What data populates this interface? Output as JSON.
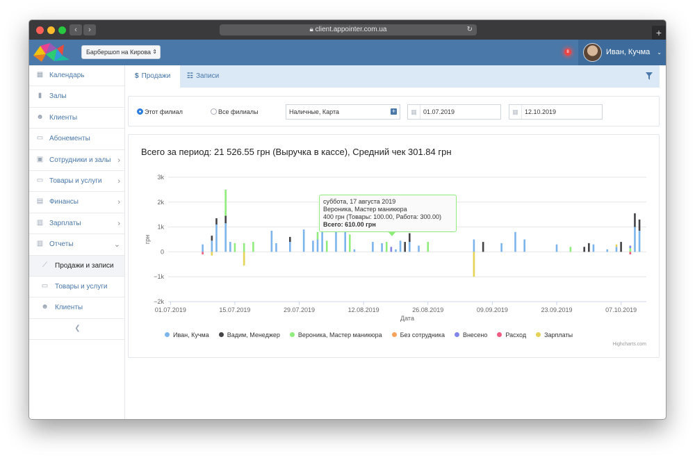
{
  "browser": {
    "url": "client.appointer.com.ua",
    "back_glyph": "‹",
    "forward_glyph": "›",
    "newtab_glyph": "+"
  },
  "header": {
    "branch": "Барбершоп на Кирова",
    "notification_count": "8",
    "user": "Иван, Кучма"
  },
  "sidebar": {
    "items": [
      {
        "label": "Календарь",
        "icon": "calendar-icon",
        "glyph": "▦",
        "chevron": ""
      },
      {
        "label": "Залы",
        "icon": "bookmark-icon",
        "glyph": "▮",
        "chevron": ""
      },
      {
        "label": "Клиенты",
        "icon": "users-icon",
        "glyph": "☻",
        "chevron": ""
      },
      {
        "label": "Абонементы",
        "icon": "card-icon",
        "glyph": "▭",
        "chevron": ""
      },
      {
        "label": "Сотрудники и залы",
        "icon": "id-card-icon",
        "glyph": "▣",
        "chevron": "›"
      },
      {
        "label": "Товары и услуги",
        "icon": "card-icon",
        "glyph": "▭",
        "chevron": "›"
      },
      {
        "label": "Финансы",
        "icon": "money-icon",
        "glyph": "▤",
        "chevron": "›"
      },
      {
        "label": "Зарплаты",
        "icon": "document-icon",
        "glyph": "▥",
        "chevron": "›"
      },
      {
        "label": "Отчеты",
        "icon": "bar-chart-icon",
        "glyph": "▥",
        "chevron": "⌄"
      }
    ],
    "subitems": [
      {
        "label": "Продажи и записи",
        "icon": "line-chart-icon",
        "glyph": "⟋",
        "active": true
      },
      {
        "label": "Товары и услуги",
        "icon": "card-icon",
        "glyph": "▭",
        "active": false
      },
      {
        "label": "Клиенты",
        "icon": "users-icon",
        "glyph": "☻",
        "active": false
      }
    ],
    "collapse_glyph": "❮"
  },
  "tabs": [
    {
      "label": "Продажи",
      "icon": "dollar-icon",
      "glyph": "$"
    },
    {
      "label": "Записи",
      "icon": "list-icon",
      "glyph": "☷"
    }
  ],
  "filters": {
    "radio_this": "Этот филиал",
    "radio_all": "Все филиалы",
    "payment": "Наличные, Карта",
    "date_from": "01.07.2019",
    "date_to": "12.10.2019"
  },
  "summary": "Всего за период: 21 526.55 грн (Выручка в кассе), Средний чек 301.84 грн",
  "tooltip": {
    "line1": "суббота, 17 августа 2019",
    "line2": "Вероника, Мастер маникюра",
    "line3": "400 грн (Товары: 100.00, Работа: 300.00)",
    "total_label": "Всего:",
    "total_value": "610.00 грн"
  },
  "credits": "Highcharts.com",
  "colors": {
    "ivan": "#7cb5ec",
    "vadim": "#434348",
    "veronika": "#90ed7d",
    "none": "#f7a35c",
    "deposit": "#8085e9",
    "expense": "#f15c80",
    "salary": "#e4d354"
  },
  "chart_data": {
    "type": "bar",
    "ylabel": "грн",
    "xlabel": "Дата",
    "ylim": [
      -2000,
      3000
    ],
    "yticks": [
      "3k",
      "2k",
      "1k",
      "0",
      "−1k",
      "−2k"
    ],
    "yvalues": [
      3000,
      2000,
      1000,
      0,
      -1000,
      -2000
    ],
    "xticks": [
      "01.07.2019",
      "15.07.2019",
      "29.07.2019",
      "12.08.2019",
      "26.08.2019",
      "09.09.2019",
      "23.09.2019",
      "07.10.2019"
    ],
    "day_range": [
      "2019-07-01",
      "2019-10-12"
    ],
    "grid": true,
    "legend_position": "bottom",
    "series": [
      {
        "name": "Иван, Кучма",
        "color": "#7cb5ec",
        "points": [
          [
            "2019-07-08",
            300
          ],
          [
            "2019-07-10",
            450
          ],
          [
            "2019-07-11",
            1100
          ],
          [
            "2019-07-13",
            1150
          ],
          [
            "2019-07-14",
            400
          ],
          [
            "2019-07-23",
            850
          ],
          [
            "2019-07-24",
            350
          ],
          [
            "2019-07-27",
            400
          ],
          [
            "2019-07-30",
            900
          ],
          [
            "2019-08-01",
            450
          ],
          [
            "2019-08-02",
            500
          ],
          [
            "2019-08-03",
            1150
          ],
          [
            "2019-08-06",
            1050
          ],
          [
            "2019-08-08",
            1100
          ],
          [
            "2019-08-10",
            100
          ],
          [
            "2019-08-14",
            400
          ],
          [
            "2019-08-16",
            350
          ],
          [
            "2019-08-19",
            100
          ],
          [
            "2019-08-20",
            450
          ],
          [
            "2019-08-22",
            400
          ],
          [
            "2019-08-24",
            250
          ],
          [
            "2019-09-05",
            500
          ],
          [
            "2019-09-11",
            350
          ],
          [
            "2019-09-14",
            800
          ],
          [
            "2019-09-16",
            500
          ],
          [
            "2019-09-23",
            300
          ],
          [
            "2019-10-01",
            300
          ],
          [
            "2019-10-04",
            100
          ],
          [
            "2019-10-06",
            200
          ],
          [
            "2019-10-10",
            1000
          ],
          [
            "2019-10-11",
            850
          ]
        ]
      },
      {
        "name": "Вадим, Менеджер",
        "color": "#434348",
        "points": [
          [
            "2019-07-10",
            200
          ],
          [
            "2019-07-11",
            250
          ],
          [
            "2019-07-13",
            300
          ],
          [
            "2019-07-27",
            200
          ],
          [
            "2019-08-06",
            200
          ],
          [
            "2019-08-21",
            400
          ],
          [
            "2019-08-22",
            350
          ],
          [
            "2019-09-07",
            400
          ],
          [
            "2019-09-29",
            200
          ],
          [
            "2019-09-30",
            350
          ],
          [
            "2019-10-07",
            400
          ],
          [
            "2019-10-10",
            550
          ],
          [
            "2019-10-11",
            450
          ]
        ]
      },
      {
        "name": "Вероника, Мастер маникюра",
        "color": "#90ed7d",
        "points": [
          [
            "2019-07-13",
            1050
          ],
          [
            "2019-07-15",
            350
          ],
          [
            "2019-07-17",
            350
          ],
          [
            "2019-07-19",
            400
          ],
          [
            "2019-08-02",
            300
          ],
          [
            "2019-08-04",
            450
          ],
          [
            "2019-08-09",
            700
          ],
          [
            "2019-08-17",
            400
          ],
          [
            "2019-08-26",
            400
          ],
          [
            "2019-09-26",
            200
          ],
          [
            "2019-10-09",
            150
          ]
        ]
      },
      {
        "name": "Без сотрудника",
        "color": "#f7a35c",
        "points": [
          [
            "2019-08-03",
            100
          ]
        ]
      },
      {
        "name": "Внесено",
        "color": "#8085e9",
        "points": [
          [
            "2019-08-18",
            200
          ],
          [
            "2019-10-09",
            100
          ]
        ]
      },
      {
        "name": "Расход",
        "color": "#f15c80",
        "points": [
          [
            "2019-07-08",
            -100
          ],
          [
            "2019-10-09",
            -100
          ]
        ]
      },
      {
        "name": "Зарплаты",
        "color": "#e4d354",
        "points": [
          [
            "2019-07-10",
            -150
          ],
          [
            "2019-07-17",
            -550
          ],
          [
            "2019-09-05",
            -1000
          ],
          [
            "2019-10-06",
            100
          ]
        ]
      }
    ]
  }
}
